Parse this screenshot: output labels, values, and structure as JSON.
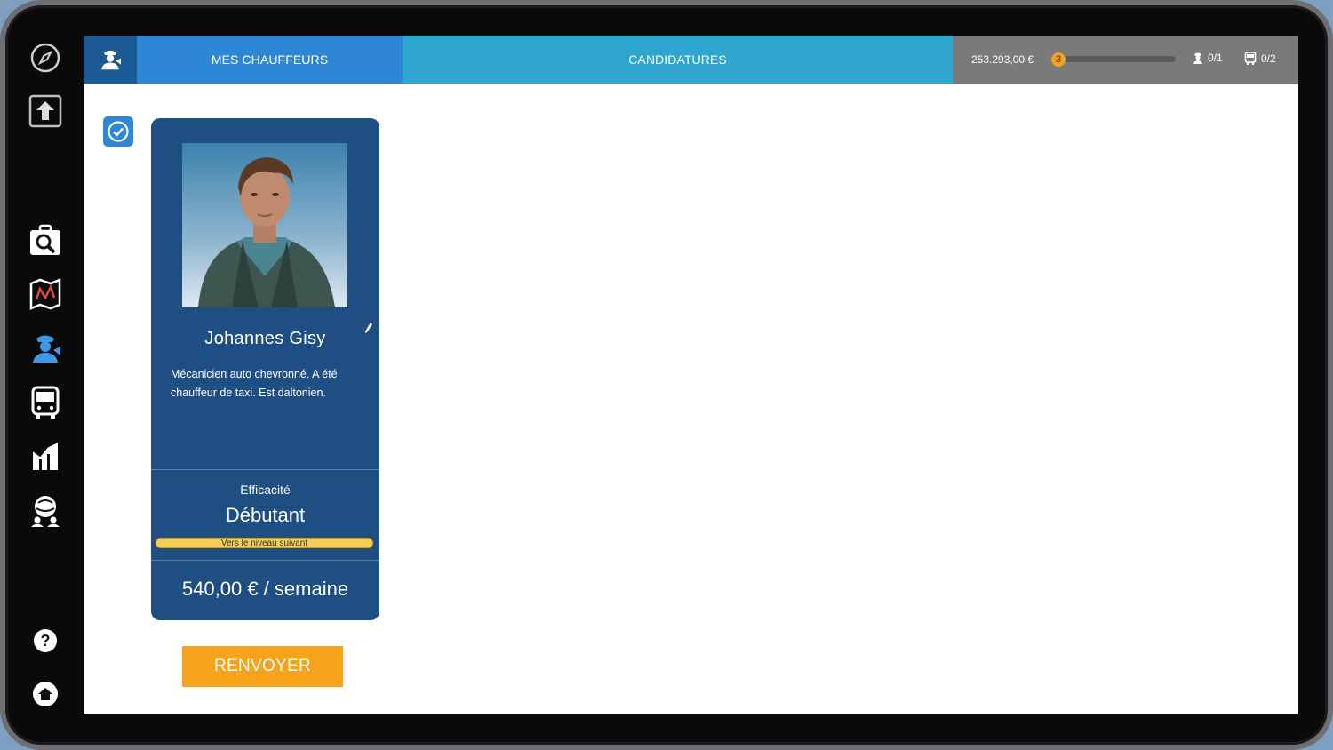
{
  "sidebar": {
    "items": [
      {
        "name": "compass-icon"
      },
      {
        "name": "export-icon"
      },
      {
        "name": "briefcase-search-icon"
      },
      {
        "name": "map-icon"
      },
      {
        "name": "drivers-icon",
        "active": true
      },
      {
        "name": "bus-icon"
      },
      {
        "name": "stats-icon"
      },
      {
        "name": "global-network-icon"
      },
      {
        "name": "help-icon"
      },
      {
        "name": "home-icon"
      }
    ]
  },
  "header": {
    "tabs": [
      {
        "label": "MES CHAUFFEURS",
        "active": true
      },
      {
        "label": "CANDIDATURES",
        "active": false
      }
    ],
    "money": "253.293,00 €",
    "level": "3",
    "level_progress": 0.05,
    "drivers_count": "0/1",
    "buses_count": "0/2"
  },
  "driver_card": {
    "name": "Johannes Gisy",
    "description": "Mécanicien auto chevronné. A été chauffeur de taxi. Est daltonien.",
    "efficiency_label": "Efficacité",
    "efficiency_value": "Débutant",
    "xp_label": "Vers le niveau suivant",
    "xp_progress": 0.0,
    "salary": "540,00 € / semaine"
  },
  "actions": {
    "fire_label": "RENVOYER"
  },
  "colors": {
    "accent_blue": "#2d87d4",
    "tab_secondary": "#2ea6cf",
    "card_bg": "#1f4f82",
    "button_orange": "#f6a21b"
  }
}
